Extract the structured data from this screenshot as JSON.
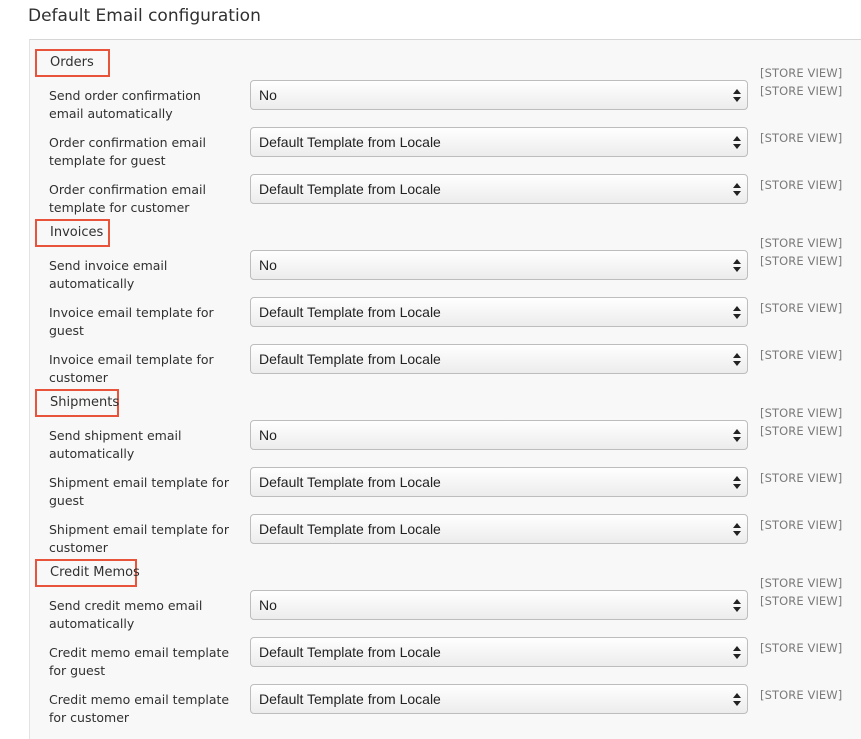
{
  "page": {
    "title": "Default Email configuration"
  },
  "scope_label": "[STORE VIEW]",
  "icons": {
    "select_arrow": "up-down-arrows-icon"
  },
  "colors": {
    "highlight_border": "#e8533b"
  },
  "sections": [
    {
      "label": "Orders",
      "fields": [
        {
          "label": "Send order confirmation email automatically",
          "value": "No"
        },
        {
          "label": "Order confirmation email template for guest",
          "value": "Default Template from Locale"
        },
        {
          "label": "Order confirmation email template for customer",
          "value": "Default Template from Locale"
        }
      ]
    },
    {
      "label": "Invoices",
      "fields": [
        {
          "label": "Send invoice email automatically",
          "value": "No"
        },
        {
          "label": "Invoice email template for guest",
          "value": "Default Template from Locale"
        },
        {
          "label": "Invoice email template for customer",
          "value": "Default Template from Locale"
        }
      ]
    },
    {
      "label": "Shipments",
      "fields": [
        {
          "label": "Send shipment email automatically",
          "value": "No"
        },
        {
          "label": "Shipment email template for guest",
          "value": "Default Template from Locale"
        },
        {
          "label": "Shipment email template for customer",
          "value": "Default Template from Locale"
        }
      ]
    },
    {
      "label": "Credit Memos",
      "fields": [
        {
          "label": "Send credit memo email automatically",
          "value": "No"
        },
        {
          "label": "Credit memo email template for guest",
          "value": "Default Template from Locale"
        },
        {
          "label": "Credit memo email template for customer",
          "value": "Default Template from Locale"
        }
      ]
    }
  ]
}
